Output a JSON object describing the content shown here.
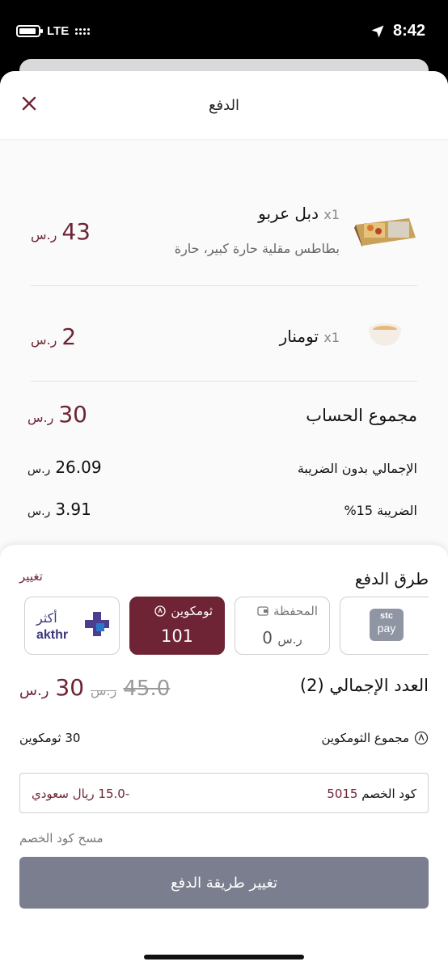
{
  "status_bar": {
    "network": "LTE",
    "time": "8:42"
  },
  "header": {
    "title": "الدفع"
  },
  "items": [
    {
      "qty": "x1",
      "name": "دبل عربو",
      "description": "بطاطس مقلية حارة كبير، حارة",
      "price": "43",
      "currency": "ر.س"
    },
    {
      "qty": "x1",
      "name": "تومنار",
      "description": "",
      "price": "2",
      "currency": "ر.س"
    }
  ],
  "summary": {
    "subtotal": {
      "label": "مجموع الحساب",
      "value": "30",
      "currency": "ر.س"
    },
    "pre_tax": {
      "label": "الإجمالي بدون الضريبة",
      "value": "26.09",
      "currency": "ر.س"
    },
    "tax": {
      "label": "الضريبة 15%",
      "value": "3.91",
      "currency": "ر.س"
    }
  },
  "payment": {
    "title": "طرق الدفع",
    "change_label": "تغيير",
    "methods": [
      {
        "name": "akthr",
        "label_ar": "أكثر",
        "label_en": "akthr"
      },
      {
        "name": "thumcoins",
        "label": "ثومكوين",
        "value": "101",
        "selected": true
      },
      {
        "name": "wallet",
        "label": "المحفظة",
        "value": "0",
        "currency": "ر.س"
      },
      {
        "name": "stcpay",
        "label_top": "stc",
        "label_bottom": "pay"
      }
    ],
    "total_label": "العدد الإجمالي (2)",
    "total_old": "45.0",
    "total_old_currency": "ر.س",
    "total_new": "30",
    "total_currency": "ر.س",
    "coins_label": "مجموع الثومكوين",
    "coins_value": "30 ثومكوين",
    "promo_label": "كود الخصم",
    "promo_code": "5015",
    "promo_discount": "-15.0 ريال سعودي",
    "clear_promo": "مسح كود الخصم",
    "cta": "تغيير طريقة الدفع"
  },
  "colors": {
    "brand": "#6e2434",
    "button": "#7a7e8f"
  }
}
